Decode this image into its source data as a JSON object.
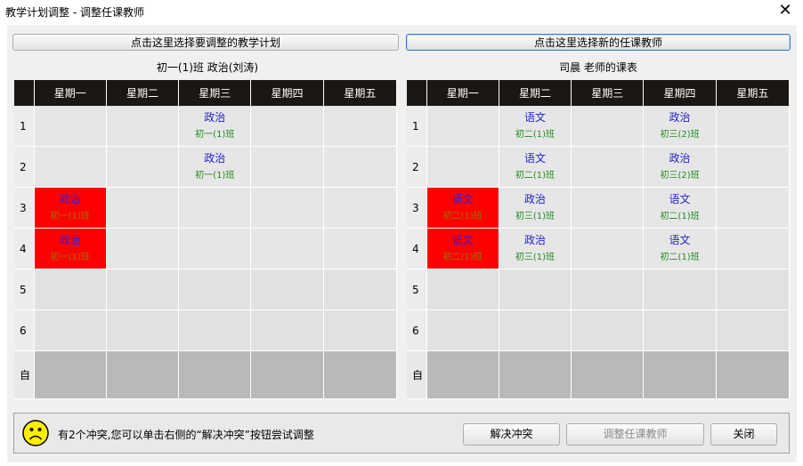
{
  "window": {
    "title": "教学计划调整 - 调整任课教师",
    "close_glyph": "✕"
  },
  "toolbar": {
    "select_plan_label": "点击这里选择要调整的教学计划",
    "select_teacher_label": "点击这里选择新的任课教师"
  },
  "left_table": {
    "caption": "初一(1)班 政治(刘涛)",
    "headers": [
      "星期一",
      "星期二",
      "星期三",
      "星期四",
      "星期五"
    ],
    "rows": [
      {
        "label": "1",
        "cells": [
          null,
          null,
          {
            "subject": "政治",
            "class": "初一(1)班"
          },
          null,
          null
        ]
      },
      {
        "label": "2",
        "cells": [
          null,
          null,
          {
            "subject": "政治",
            "class": "初一(1)班"
          },
          null,
          null
        ]
      },
      {
        "label": "3",
        "cells": [
          {
            "subject": "政治",
            "class": "初一(1)班",
            "conflict": true
          },
          null,
          null,
          null,
          null
        ]
      },
      {
        "label": "4",
        "cells": [
          {
            "subject": "政治",
            "class": "初一(1)班",
            "conflict": true
          },
          null,
          null,
          null,
          null
        ]
      },
      {
        "label": "5",
        "cells": [
          null,
          null,
          null,
          null,
          null
        ]
      },
      {
        "label": "6",
        "cells": [
          null,
          null,
          null,
          null,
          null
        ]
      },
      {
        "label": "自",
        "cells": [
          null,
          null,
          null,
          null,
          null
        ]
      }
    ]
  },
  "right_table": {
    "caption": "司晨 老师的课表",
    "headers": [
      "星期一",
      "星期二",
      "星期三",
      "星期四",
      "星期五"
    ],
    "rows": [
      {
        "label": "1",
        "cells": [
          null,
          {
            "subject": "语文",
            "class": "初二(1)班"
          },
          null,
          {
            "subject": "政治",
            "class": "初三(2)班"
          },
          null
        ]
      },
      {
        "label": "2",
        "cells": [
          null,
          {
            "subject": "语文",
            "class": "初二(1)班"
          },
          null,
          {
            "subject": "政治",
            "class": "初三(2)班"
          },
          null
        ]
      },
      {
        "label": "3",
        "cells": [
          {
            "subject": "语文",
            "class": "初二(1)班",
            "conflict": true
          },
          {
            "subject": "政治",
            "class": "初三(1)班"
          },
          null,
          {
            "subject": "语文",
            "class": "初二(1)班"
          },
          null
        ]
      },
      {
        "label": "4",
        "cells": [
          {
            "subject": "语文",
            "class": "初二(1)班",
            "conflict": true
          },
          {
            "subject": "政治",
            "class": "初三(1)班"
          },
          null,
          {
            "subject": "语文",
            "class": "初二(1)班"
          },
          null
        ]
      },
      {
        "label": "5",
        "cells": [
          null,
          null,
          null,
          null,
          null
        ]
      },
      {
        "label": "6",
        "cells": [
          null,
          null,
          null,
          null,
          null
        ]
      },
      {
        "label": "自",
        "cells": [
          null,
          null,
          null,
          null,
          null
        ]
      }
    ]
  },
  "status": {
    "icon": "sad-face-icon",
    "message": "有2个冲突,您可以单击右侧的“解决冲突”按钮尝试调整",
    "resolve_label": "解决冲突",
    "adjust_label": "调整任课教师",
    "close_label": "关闭"
  },
  "colors": {
    "header_bg": "#1b1714",
    "conflict": "#ff0000",
    "subject_text": "#2323c8",
    "class_text": "#1f8a1f"
  }
}
